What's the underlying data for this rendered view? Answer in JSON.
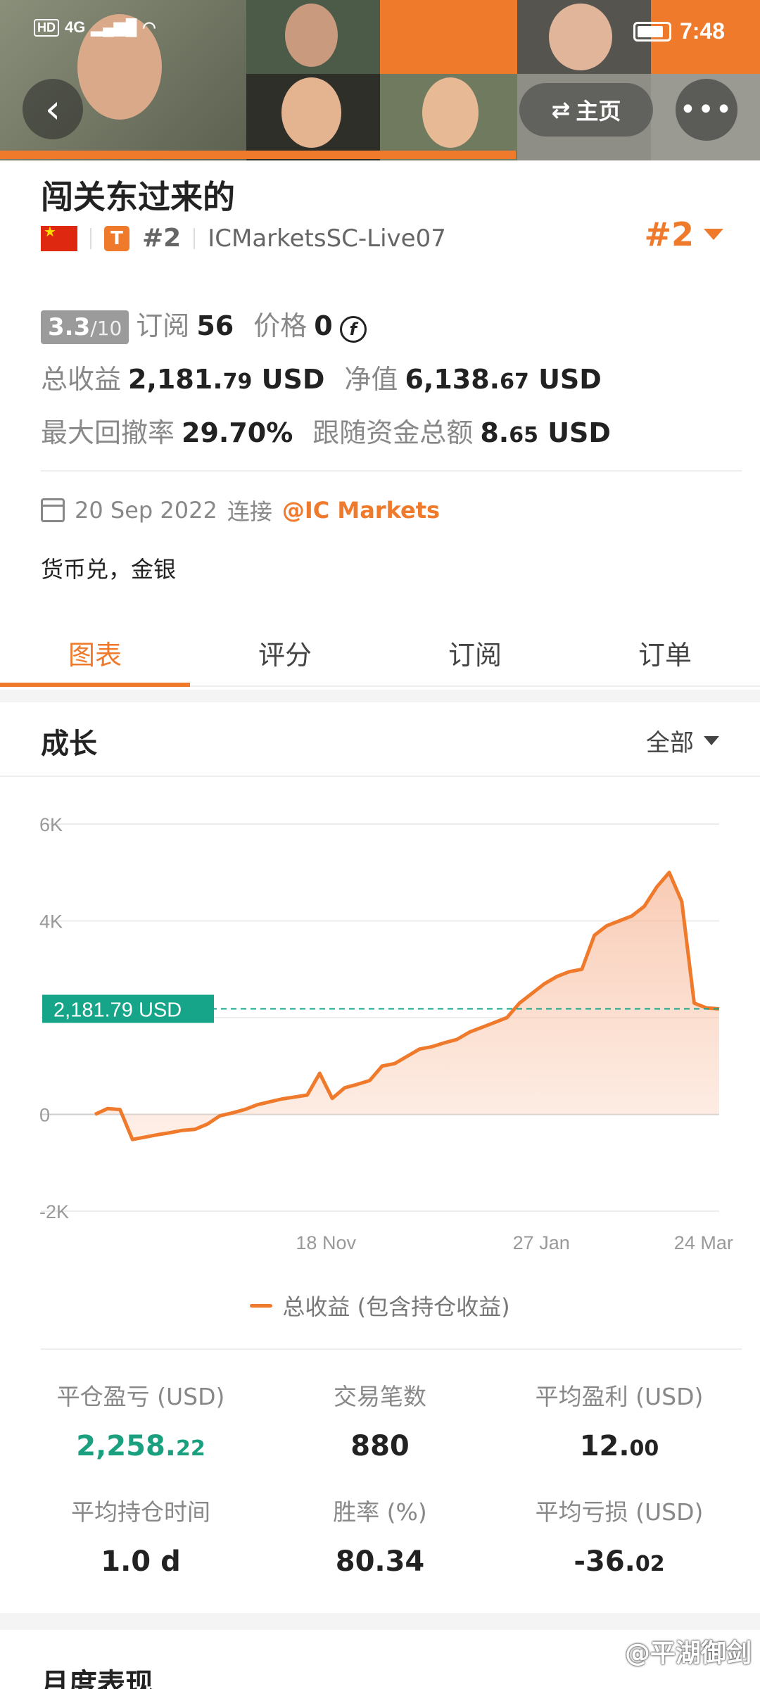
{
  "status_bar": {
    "network": "4G",
    "hd": "HD",
    "time": "7:48"
  },
  "header": {
    "home_label": "主页"
  },
  "profile": {
    "name": "闯关东过来的",
    "tier": "T",
    "rank_small": "#2",
    "server": "ICMarketsSC-Live07",
    "rank_big": "#2"
  },
  "stats": {
    "score_main": "3.3",
    "score_denom": "/10",
    "subscribe_label": "订阅",
    "subscribe_value": "56",
    "price_label": "价格",
    "price_value": "0",
    "total_profit_label": "总收益",
    "total_profit_int": "2,181.",
    "total_profit_dec": "79",
    "total_profit_unit": "USD",
    "equity_label": "净值",
    "equity_int": "6,138.",
    "equity_dec": "67",
    "equity_unit": "USD",
    "drawdown_label": "最大回撤率",
    "drawdown_value": "29.70%",
    "follow_label": "跟随资金总额",
    "follow_int": "8.",
    "follow_dec": "65",
    "follow_unit": "USD"
  },
  "connection": {
    "date": "20 Sep 2022",
    "connect_label": "连接",
    "broker": "@IC Markets"
  },
  "description": "货币兑，金银",
  "tabs": [
    "图表",
    "评分",
    "订阅",
    "订单"
  ],
  "growth": {
    "title": "成长",
    "range": "全部"
  },
  "chart_data": {
    "type": "area",
    "x_tick_labels": [
      "18 Nov",
      "27 Jan",
      "24 Mar"
    ],
    "y_tick_labels": [
      "6K",
      "4K",
      "0",
      "-2K"
    ],
    "ylim": [
      -2000,
      6000
    ],
    "current_label": "2,181.79 USD",
    "current_value": 2181.79,
    "series": [
      {
        "name": "总收益 (包含持仓收益)",
        "color": "#f07a2c",
        "values": [
          0,
          120,
          100,
          -520,
          -470,
          -420,
          -380,
          -330,
          -310,
          -200,
          -30,
          30,
          100,
          200,
          260,
          320,
          360,
          400,
          850,
          330,
          550,
          620,
          700,
          1000,
          1050,
          1200,
          1350,
          1400,
          1480,
          1550,
          1700,
          1800,
          1900,
          2000,
          2300,
          2500,
          2700,
          2850,
          2950,
          3000,
          3700,
          3900,
          4000,
          4100,
          4300,
          4700,
          5000,
          4400,
          2300,
          2200,
          2181.79
        ]
      }
    ],
    "grid": true,
    "legend": "bottom-center"
  },
  "summary": [
    {
      "label": "平仓盈亏 (USD)",
      "int": "2,258.",
      "dec": "22",
      "color": "green"
    },
    {
      "label": "交易笔数",
      "int": "880",
      "dec": "",
      "color": "default"
    },
    {
      "label": "平均盈利 (USD)",
      "int": "12.",
      "dec": "00",
      "color": "default"
    },
    {
      "label": "平均持仓时间",
      "int": "1.0 d",
      "dec": "",
      "color": "default"
    },
    {
      "label": "胜率 (%)",
      "int": "80.34",
      "dec": "",
      "color": "default"
    },
    {
      "label": "平均亏损 (USD)",
      "int": "-36.",
      "dec": "02",
      "color": "default"
    }
  ],
  "monthly_title": "月度表现",
  "watermark": "@平湖御剑",
  "colors": {
    "accent": "#f07a2c",
    "green": "#1aa07f",
    "label_bg": "#17a589"
  }
}
